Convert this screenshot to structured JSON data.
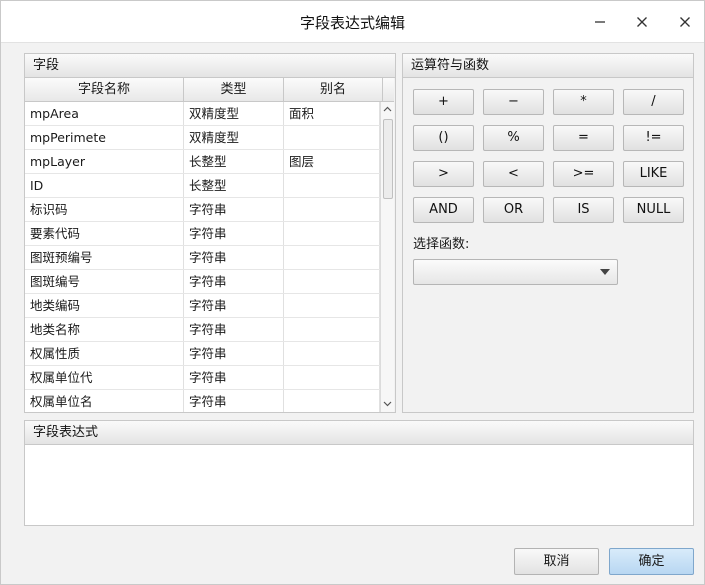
{
  "window": {
    "title": "字段表达式编辑"
  },
  "fields_panel": {
    "header": "字段",
    "columns": [
      "字段名称",
      "类型",
      "别名"
    ],
    "rows": [
      {
        "name": "mpArea",
        "type": "双精度型",
        "alias": "面积"
      },
      {
        "name": "mpPerimete",
        "type": "双精度型",
        "alias": ""
      },
      {
        "name": "mpLayer",
        "type": "长整型",
        "alias": "图层"
      },
      {
        "name": "ID",
        "type": "长整型",
        "alias": ""
      },
      {
        "name": "标识码",
        "type": "字符串",
        "alias": ""
      },
      {
        "name": "要素代码",
        "type": "字符串",
        "alias": ""
      },
      {
        "name": "图斑预编号",
        "type": "字符串",
        "alias": ""
      },
      {
        "name": "图斑编号",
        "type": "字符串",
        "alias": ""
      },
      {
        "name": "地类编码",
        "type": "字符串",
        "alias": ""
      },
      {
        "name": "地类名称",
        "type": "字符串",
        "alias": ""
      },
      {
        "name": "权属性质",
        "type": "字符串",
        "alias": ""
      },
      {
        "name": "权属单位代",
        "type": "字符串",
        "alias": ""
      },
      {
        "name": "权属单位名",
        "type": "字符串",
        "alias": ""
      }
    ]
  },
  "operators_panel": {
    "header": "运算符与函数",
    "buttons": [
      "+",
      "−",
      "*",
      "/",
      "()",
      "%",
      "=",
      "!=",
      ">",
      "<",
      ">=",
      "LIKE",
      "AND",
      "OR",
      "IS",
      "NULL"
    ],
    "function_label": "选择函数:",
    "function_value": ""
  },
  "expression_panel": {
    "header": "字段表达式",
    "value": ""
  },
  "dialog_buttons": {
    "cancel": "取消",
    "ok": "确定"
  },
  "colors": {
    "ok_button": "#b8d7f2",
    "panel_border": "#c8c8c8"
  }
}
